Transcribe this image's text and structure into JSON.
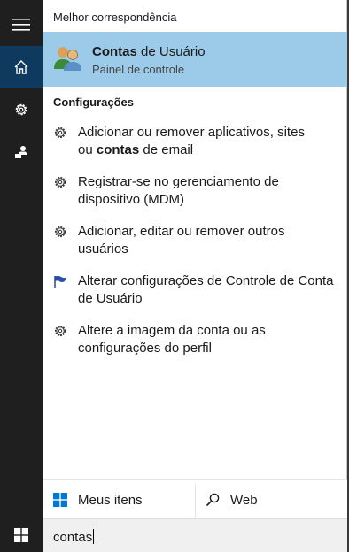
{
  "rail": {
    "icons": [
      "hamburger-menu-icon",
      "home-icon",
      "gear-icon",
      "feedback-icon"
    ]
  },
  "best_match": {
    "header": "Melhor correspondência",
    "title_bold": "Contas",
    "title_rest": " de Usuário",
    "subtitle": "Painel de controle",
    "icon": "user-accounts-icon",
    "highlight_color": "#9ccbe9"
  },
  "settings": {
    "header": "Configurações",
    "items": [
      {
        "icon": "gear-icon",
        "line1": "Adicionar ou remover aplicativos, sites",
        "line2_pre": "ou ",
        "line2_bold": "contas",
        "line2_post": " de email"
      },
      {
        "icon": "gear-icon",
        "line1": "Registrar-se no gerenciamento de",
        "line2": "dispositivo (MDM)"
      },
      {
        "icon": "gear-icon",
        "line1": "Adicionar, editar ou remover outros",
        "line2": "usuários"
      },
      {
        "icon": "flag-icon",
        "line1": "Alterar configurações de Controle de Conta",
        "line2": "de Usuário"
      },
      {
        "icon": "gear-icon",
        "line1": "Altere a imagem da conta ou as",
        "line2": "configurações do perfil"
      }
    ]
  },
  "tabs": {
    "my_items": "Meus itens",
    "web": "Web"
  },
  "search": {
    "value": "contas"
  },
  "colors": {
    "rail_bg": "#1f1f1f",
    "rail_active": "#0f3a60",
    "windows_blue": "#0078d7"
  }
}
